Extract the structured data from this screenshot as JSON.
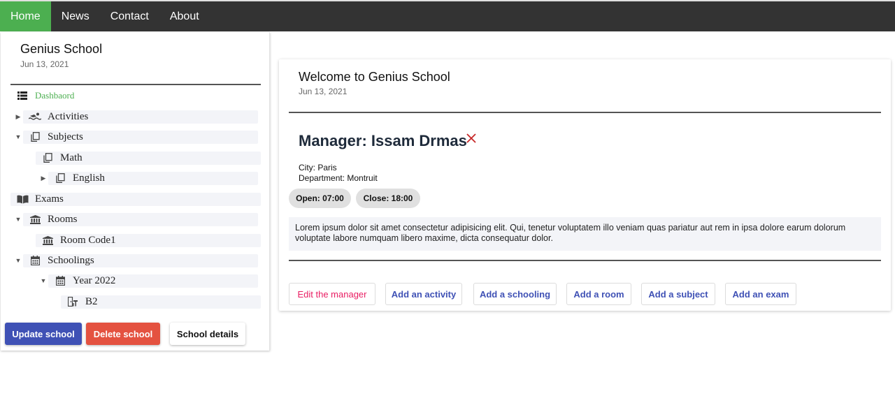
{
  "nav": {
    "items": [
      {
        "label": "Home",
        "active": true
      },
      {
        "label": "News"
      },
      {
        "label": "Contact"
      },
      {
        "label": "About"
      }
    ],
    "colors": {
      "bar": "#333333",
      "active": "#4caf50"
    }
  },
  "sidebar": {
    "school_name": "Genius School",
    "date": "Jun 13, 2021",
    "tree": {
      "dashboard": "Dashbaord",
      "activities": "Activities",
      "subjects": "Subjects",
      "math": "Math",
      "english": "English",
      "exams": "Exams",
      "rooms": "Rooms",
      "room_code1": "Room Code1",
      "schoolings": "Schoolings",
      "year_2022": "Year 2022",
      "b2": "B2"
    },
    "buttons": {
      "update": "Update school",
      "delete": "Delete school",
      "details": "School details"
    }
  },
  "main": {
    "title": "Welcome to Genius School",
    "date": "Jun 13, 2021",
    "manager": "Manager: Issam Drmas",
    "city": "City: Paris",
    "department": "Department: Montruit",
    "open": "Open: 07:00",
    "close": "Close: 18:00",
    "description": "Lorem ipsum dolor sit amet consectetur adipisicing elit. Qui, tenetur voluptatem illo veniam quas pariatur aut rem in ipsa dolore earum dolorum voluptate labore numquam libero maxime, dicta consequatur dolor.",
    "actions": {
      "edit_manager": "Edit the manager",
      "add_activity": "Add an activity",
      "add_schooling": "Add a schooling",
      "add_room": "Add a room",
      "add_subject": "Add a subject",
      "add_exam": "Add an exam"
    }
  }
}
